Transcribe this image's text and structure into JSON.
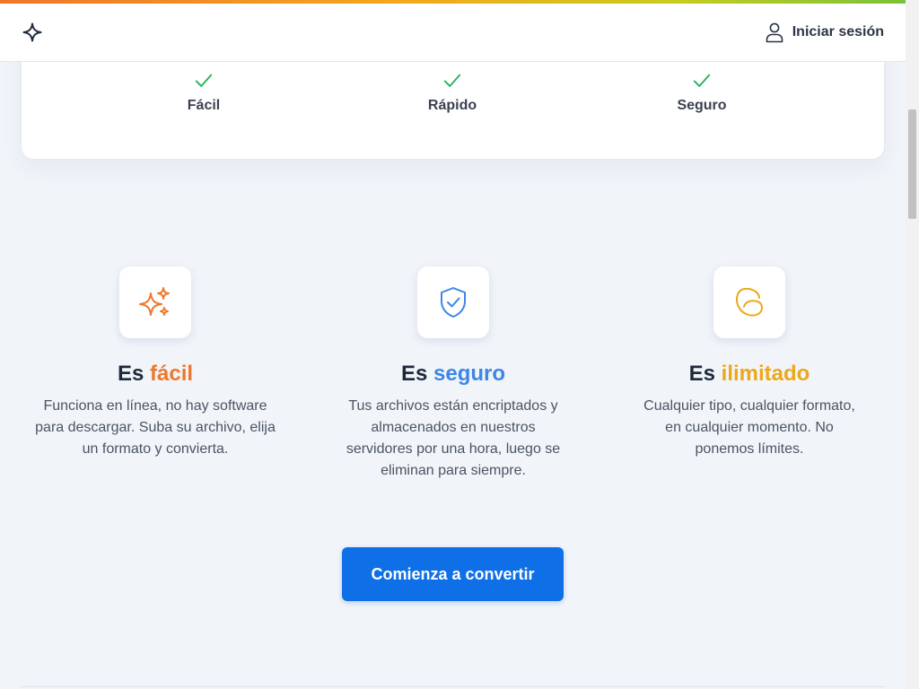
{
  "header": {
    "logo_icon": "sparkle-star-icon",
    "login_label": "Iniciar sesión",
    "login_icon": "user-icon"
  },
  "features": [
    {
      "label": "Fácil",
      "icon": "check-icon"
    },
    {
      "label": "Rápido",
      "icon": "check-icon"
    },
    {
      "label": "Seguro",
      "icon": "check-icon"
    }
  ],
  "benefits": [
    {
      "title_prefix": "Es",
      "title_highlight": "fácil",
      "icon": "sparkles-icon",
      "description": "Funciona en línea, no hay software para descargar. Suba su archivo, elija un formato y convierta."
    },
    {
      "title_prefix": "Es",
      "title_highlight": "seguro",
      "icon": "shield-check-icon",
      "description": "Tus archivos están encriptados y almacenados en nuestros servidores por una hora, luego se eliminan para siempre."
    },
    {
      "title_prefix": "Es",
      "title_highlight": "ilimitado",
      "icon": "infinity-loop-icon",
      "description": "Cualquier tipo, cualquier formato, en cualquier momento. No ponemos límites."
    }
  ],
  "cta": {
    "label": "Comienza a convertir"
  },
  "colors": {
    "accent_blue": "#0e6fe6",
    "highlight_orange": "#f0762a",
    "highlight_blue": "#3d86e8",
    "highlight_yellow": "#eba81b",
    "check_green": "#22b35a"
  }
}
